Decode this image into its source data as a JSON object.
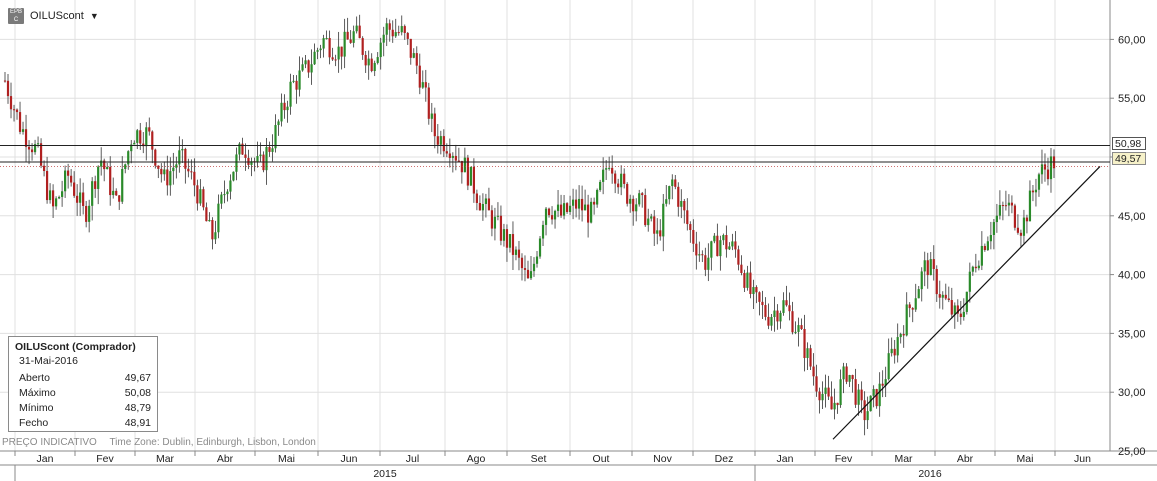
{
  "header": {
    "symbol": "OILUScont",
    "icon_text": "EPB C",
    "dropdown_icon": "caret-down-icon"
  },
  "info_box": {
    "title": "OILUScont (Comprador)",
    "date": "31-Mai-2016",
    "rows": [
      {
        "label": "Aberto",
        "value": "49,67"
      },
      {
        "label": "Máximo",
        "value": "50,08"
      },
      {
        "label": "Mínimo",
        "value": "48,79"
      },
      {
        "label": "Fecho",
        "value": "48,91"
      }
    ]
  },
  "footer": {
    "note": "PREÇO INDICATIVO",
    "timezone": "Time Zone: Dublin, Edinburgh, Lisbon, London"
  },
  "price_tags": {
    "high": "50,98",
    "last": "49,57"
  },
  "colors": {
    "up": "#2a8a2a",
    "down": "#b02020",
    "wick": "#333333",
    "grid": "#e0e0e0",
    "axis": "#888888"
  },
  "chart_data": {
    "type": "candlestick",
    "y_axis": {
      "min": 25,
      "max": 62.5,
      "ticks": [
        "25,00",
        "30,00",
        "35,00",
        "40,00",
        "45,00",
        "50,00",
        "55,00",
        "60,00"
      ],
      "tick_values": [
        25,
        30,
        35,
        40,
        45,
        50,
        55,
        60
      ],
      "position": "right"
    },
    "x_axis": {
      "months": [
        "Jan",
        "Fev",
        "Mar",
        "Abr",
        "Mai",
        "Jun",
        "Jul",
        "Ago",
        "Set",
        "Out",
        "Nov",
        "Dez",
        "Jan",
        "Fev",
        "Mar",
        "Abr",
        "Mai",
        "Jun"
      ],
      "years": [
        {
          "label": "2015"
        },
        {
          "label": "2016"
        }
      ]
    },
    "anchor_points": [
      [
        0,
        56.5
      ],
      [
        1,
        52.5
      ],
      [
        2,
        50.5
      ],
      [
        3,
        45.5
      ],
      [
        4,
        48.5
      ],
      [
        5,
        45
      ],
      [
        6,
        50
      ],
      [
        7,
        46
      ],
      [
        8,
        52
      ],
      [
        9,
        52
      ],
      [
        10,
        48
      ],
      [
        11,
        50
      ],
      [
        12,
        47.5
      ],
      [
        13,
        43
      ],
      [
        14,
        48
      ],
      [
        15,
        51
      ],
      [
        16,
        49
      ],
      [
        17,
        52
      ],
      [
        18,
        56
      ],
      [
        19,
        57.5
      ],
      [
        20,
        60
      ],
      [
        21,
        59
      ],
      [
        22,
        60.5
      ],
      [
        23,
        58
      ],
      [
        24,
        61
      ],
      [
        25,
        60.5
      ],
      [
        26,
        57.5
      ],
      [
        27,
        52
      ],
      [
        28,
        51
      ],
      [
        29,
        49
      ],
      [
        30,
        46
      ],
      [
        31,
        44
      ],
      [
        32,
        42
      ],
      [
        33,
        39
      ],
      [
        34,
        46
      ],
      [
        35,
        45
      ],
      [
        36,
        46
      ],
      [
        37,
        45
      ],
      [
        38,
        50
      ],
      [
        39,
        47
      ],
      [
        40,
        46
      ],
      [
        41,
        43
      ],
      [
        42,
        48
      ],
      [
        43,
        44
      ],
      [
        44,
        41
      ],
      [
        45,
        43
      ],
      [
        46,
        42
      ],
      [
        47,
        38
      ],
      [
        48,
        36.5
      ],
      [
        49,
        37.5
      ],
      [
        50,
        35
      ],
      [
        51,
        31
      ],
      [
        52,
        28.5
      ],
      [
        53,
        32
      ],
      [
        54,
        28
      ],
      [
        55,
        30
      ],
      [
        56,
        34
      ],
      [
        57,
        37.5
      ],
      [
        58,
        41
      ],
      [
        59,
        38
      ],
      [
        60,
        36
      ],
      [
        61,
        41
      ],
      [
        62,
        44
      ],
      [
        63,
        46
      ],
      [
        64,
        44
      ],
      [
        65,
        48.5
      ],
      [
        66,
        49.6
      ]
    ],
    "overlays": {
      "horizontal_lines": [
        50.98,
        49.57,
        49.2
      ],
      "trendline": {
        "from": [
          "Fev 2016",
          26.0
        ],
        "to": [
          "Jun 2016",
          49.2
        ]
      }
    },
    "grid": true
  }
}
